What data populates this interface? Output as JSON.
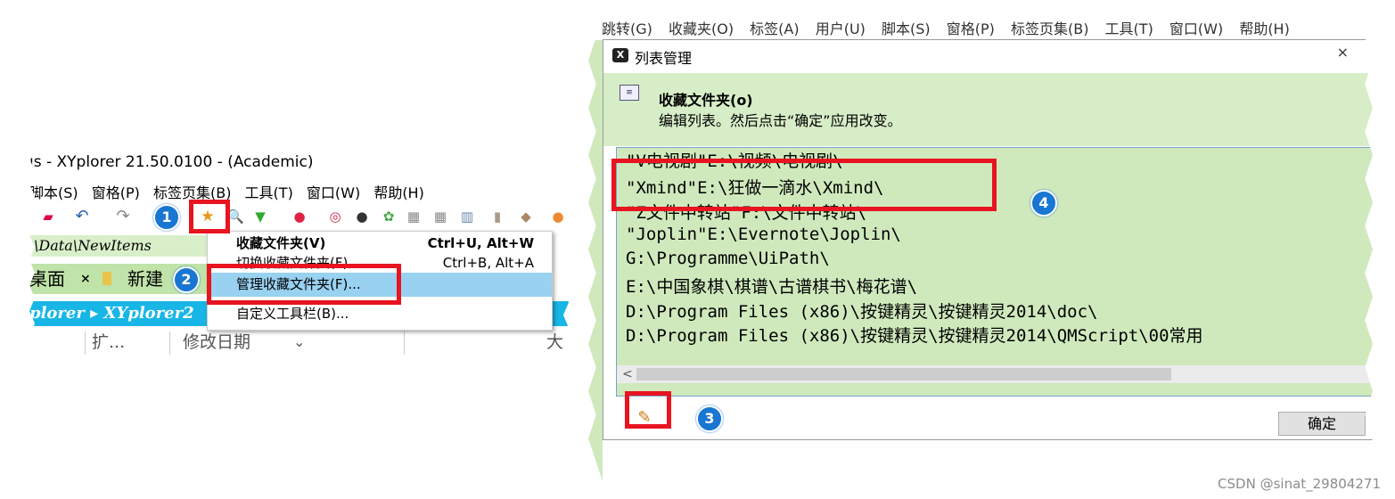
{
  "left_window": {
    "title": "ıs - XYplorer 21.50.0100 - (Academic)",
    "menubar": [
      "脚本(S)",
      "窗格(P)",
      "标签页集(B)",
      "工具(T)",
      "窗口(W)",
      "帮助(H)"
    ],
    "address": "\\Data\\NewItems",
    "tabs": [
      {
        "label": "桌面",
        "close": "×"
      },
      {
        "label": "新建"
      }
    ],
    "path": "plorer ▸ XYplorer2",
    "columns": [
      "扩...",
      "修改日期",
      "大"
    ],
    "sort_glyph": "⌄",
    "toolbar_icons": [
      "eraser-icon",
      "undo-icon",
      "redo-icon",
      "favorite-star-icon",
      "search-icon",
      "filter-icon",
      "color-icon",
      "target-icon",
      "circle-icon",
      "tree-icon",
      "pane-icon"
    ]
  },
  "context_menu": {
    "items": [
      {
        "label": "收藏文件夹(V)",
        "shortcut": "Ctrl+U, Alt+W",
        "bold": true
      },
      {
        "label": "切换收藏文件夹(F)",
        "shortcut": "Ctrl+B, Alt+A"
      },
      {
        "label": "管理收藏文件夹(F)...",
        "shortcut": "",
        "selected": true
      },
      {
        "label": "自定义工具栏(B)...",
        "shortcut": ""
      }
    ]
  },
  "right_window": {
    "background_menu": [
      "跳转(G)",
      "收藏夹(O)",
      "标签(A)",
      "用户(U)",
      "脚本(S)",
      "窗格(P)",
      "标签页集(B)",
      "工具(T)",
      "窗口(W)",
      "帮助(H)"
    ]
  },
  "dialog": {
    "title": "列表管理",
    "close_glyph": "×",
    "header_title": "收藏文件夹(o)",
    "header_subtitle": "编辑列表。然后点击“确定”应用改变。",
    "lines": [
      "\"V电视剧\"E:\\视频\\电视剧\\",
      "\"Xmind\"E:\\狂做一滴水\\Xmind\\",
      "\"Z文件中转站\"F:\\文件中转站\\",
      "\"Joplin\"E:\\Evernote\\Joplin\\",
      "G:\\Programme\\UiPath\\",
      "E:\\中国象棋\\棋谱\\古谱棋书\\梅花谱\\",
      "D:\\Program Files (x86)\\按键精灵\\按键精灵2014\\doc\\",
      "D:\\Program Files (x86)\\按键精灵\\按键精灵2014\\QMScript\\00常用"
    ],
    "ok_label": "确定",
    "edit_icon": "✎",
    "scroll_left": "<"
  },
  "annotations": {
    "badges": [
      "1",
      "2",
      "3",
      "4"
    ],
    "color": "#e8141f",
    "badge_color": "#1976d2"
  },
  "watermark": "CSDN @sinat_29804271"
}
